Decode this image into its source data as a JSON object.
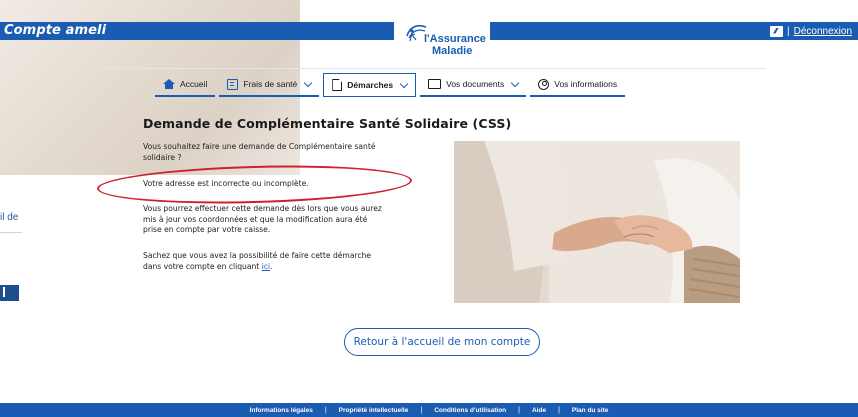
{
  "background_page": {
    "partial_text": "il de"
  },
  "header": {
    "brand": "Compte ameli",
    "logo_line1": "l'Assurance",
    "logo_line2": "Maladie",
    "logout_separator": "|",
    "logout_label": "Déconnexion",
    "bar_color": "#1b5cb3"
  },
  "nav": {
    "items": [
      {
        "label": "Accueil",
        "icon": "home-icon",
        "dropdown": false
      },
      {
        "label": "Frais de santé",
        "icon": "receipt-icon",
        "dropdown": true
      },
      {
        "label": "Démarches",
        "icon": "document-icon",
        "dropdown": true,
        "active": true
      },
      {
        "label": "Vos documents",
        "icon": "folder-icon",
        "dropdown": true
      },
      {
        "label": "Vos informations",
        "icon": "user-circle-icon",
        "dropdown": false
      }
    ]
  },
  "main": {
    "title": "Demande de Complémentaire Santé Solidaire (CSS)",
    "p1": "Vous souhaitez faire une demande de Complémentaire santé solidaire ?",
    "p2": "Votre adresse est incorrecte ou incomplète.",
    "p3": "Vous pourrez effectuer cette demande dès lors que vous aurez mis à jour vos coordonnées et que la modification aura été prise en compte par votre caisse.",
    "p4_before": "Sachez que vous avez la possibilité de faire cette démarche dans votre compte en cliquant ",
    "p4_link": "ici",
    "p4_after": ".",
    "highlight_color": "#d01f2e"
  },
  "return_button": {
    "label": "Retour à l'accueil de mon compte"
  },
  "footer": {
    "items": [
      "Informations légales",
      "Propriété intellectuelle",
      "Conditions d'utilisation",
      "Aide",
      "Plan du site"
    ],
    "separator": "|"
  }
}
